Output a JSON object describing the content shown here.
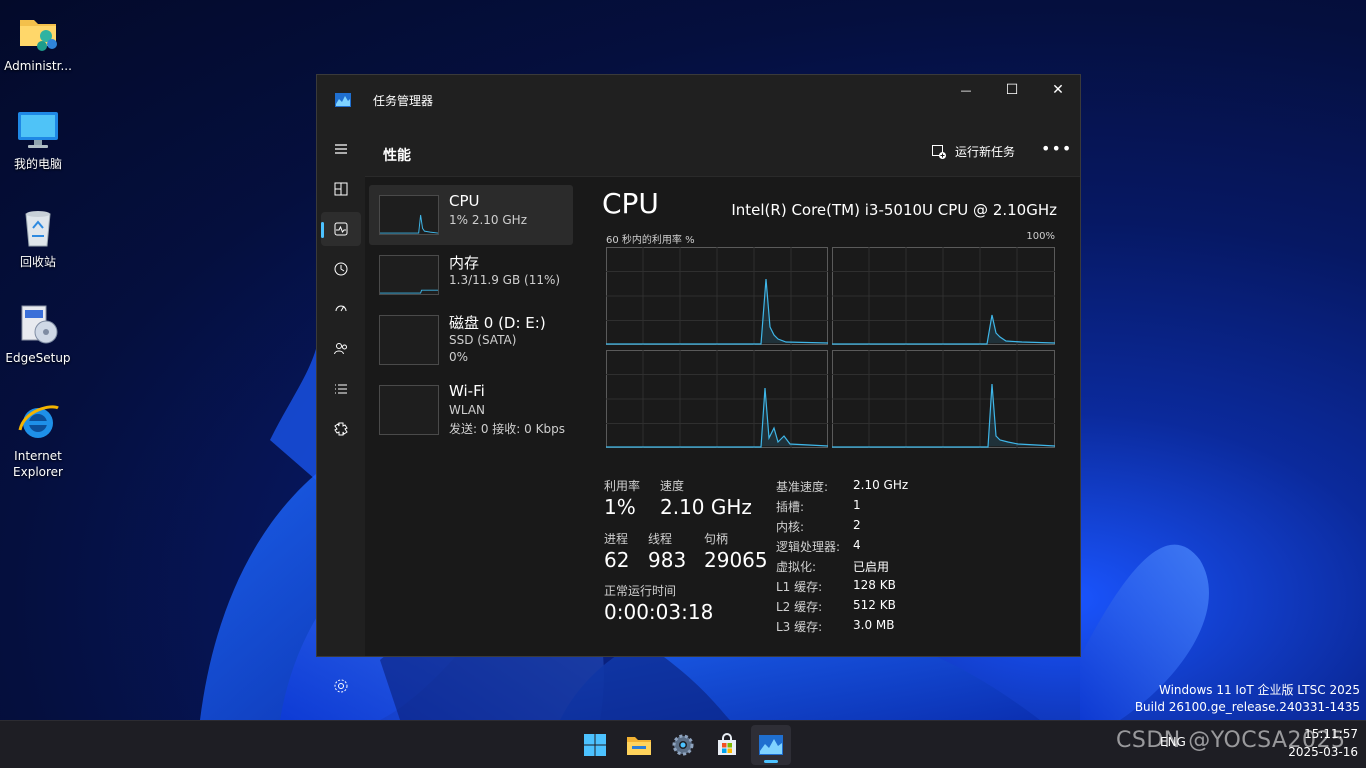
{
  "desktop": {
    "icons": [
      {
        "label": "Administr...",
        "icon": "user-folder-icon"
      },
      {
        "label": "我的电脑",
        "icon": "computer-icon"
      },
      {
        "label": "回收站",
        "icon": "recycle-bin-icon"
      },
      {
        "label": "EdgeSetup",
        "icon": "installer-icon"
      },
      {
        "label": "Internet\nExplorer",
        "icon": "internet-explorer-icon"
      }
    ],
    "build_line1": "Windows 11 IoT 企业版 LTSC 2025",
    "build_line2": "Build 26100.ge_release.240331-1435"
  },
  "window": {
    "title": "任务管理器",
    "controls": {
      "minimize": "—",
      "maximize": "☐",
      "close": "✕"
    },
    "nav": [
      "hamburger-icon",
      "processes-icon",
      "performance-icon",
      "app-history-icon",
      "startup-icon",
      "users-icon",
      "details-icon",
      "services-icon"
    ],
    "header": {
      "title": "性能",
      "run_task": "运行新任务",
      "more": "•••"
    },
    "devices": [
      {
        "name": "CPU",
        "sub1": "1% 2.10 GHz",
        "sub2": "",
        "sub3": ""
      },
      {
        "name": "内存",
        "sub1": "1.3/11.9 GB (11%)",
        "sub2": "",
        "sub3": ""
      },
      {
        "name": "磁盘 0 (D: E:)",
        "sub1": "SSD (SATA)",
        "sub2": "0%",
        "sub3": ""
      },
      {
        "name": "Wi-Fi",
        "sub1": "WLAN",
        "sub2": "发送: 0 接收: 0 Kbps",
        "sub3": ""
      }
    ],
    "detail": {
      "title": "CPU",
      "model": "Intel(R) Core(TM) i3-5010U CPU @ 2.10GHz",
      "graph_caption_left": "60 秒内的利用率 %",
      "graph_caption_right": "100%",
      "utilization_label": "利用率",
      "utilization_value": "1%",
      "speed_label": "速度",
      "speed_value": "2.10 GHz",
      "processes_label": "进程",
      "processes_value": "62",
      "threads_label": "线程",
      "threads_value": "983",
      "handles_label": "句柄",
      "handles_value": "29065",
      "uptime_label": "正常运行时间",
      "uptime_value": "0:00:03:18",
      "specs": [
        {
          "k": "基准速度:",
          "v": "2.10 GHz"
        },
        {
          "k": "插槽:",
          "v": "1"
        },
        {
          "k": "内核:",
          "v": "2"
        },
        {
          "k": "逻辑处理器:",
          "v": "4"
        },
        {
          "k": "虚拟化:",
          "v": "已启用"
        },
        {
          "k": "L1 缓存:",
          "v": "128 KB"
        },
        {
          "k": "L2 缓存:",
          "v": "512 KB"
        },
        {
          "k": "L3 缓存:",
          "v": "3.0 MB"
        }
      ]
    },
    "accent": "#4cc2ff"
  },
  "taskbar": {
    "icons": [
      "start-icon",
      "file-explorer-icon",
      "settings-icon",
      "store-icon",
      "task-manager-icon"
    ],
    "tray_lang": "ENG",
    "clock_time": "15:11:57",
    "clock_date": "2025-03-16"
  },
  "watermark": "CSDN @YOCSA2025"
}
